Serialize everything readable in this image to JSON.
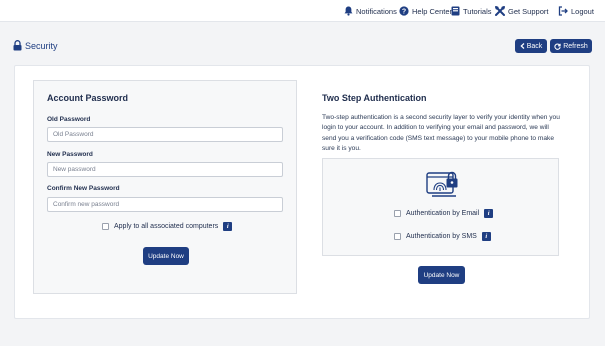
{
  "topbar": {
    "notifications": "Notifications",
    "help_center": "Help Center",
    "tutorials": "Tutorials",
    "get_support": "Get Support",
    "logout": "Logout"
  },
  "page": {
    "title": "Security",
    "back_label": "Back",
    "refresh_label": "Refresh"
  },
  "account_password": {
    "title": "Account Password",
    "old_label": "Old Password",
    "old_placeholder": "Old Password",
    "new_label": "New Password",
    "new_placeholder": "New password",
    "confirm_label": "Confirm New Password",
    "confirm_placeholder": "Confirm new password",
    "apply_all_label": "Apply to all associated computers",
    "info_glyph": "i",
    "update_label": "Update Now"
  },
  "two_step": {
    "title": "Two Step Authentication",
    "description": "Two-step authentication is a second security layer to verify your identity when you login to your account. In addition to verifying your email and password, we will send you a verification code (SMS text message) to your mobile phone to make sure it is you.",
    "email_label": "Authentication by Email",
    "sms_label": "Authentication by SMS",
    "info_glyph": "i",
    "update_label": "Update Now"
  },
  "colors": {
    "primary": "#1f3e82",
    "text": "#1f2d4d",
    "background": "#f3f4f6"
  },
  "icons": {
    "notifications": "bell-icon",
    "help": "question-circle-icon",
    "tutorials": "book-icon",
    "support": "tools-icon",
    "logout": "sign-out-icon",
    "security": "lock-icon",
    "back": "chevron-left-icon",
    "refresh": "refresh-icon",
    "auth_illustration": "fingerprint-lock-icon"
  }
}
